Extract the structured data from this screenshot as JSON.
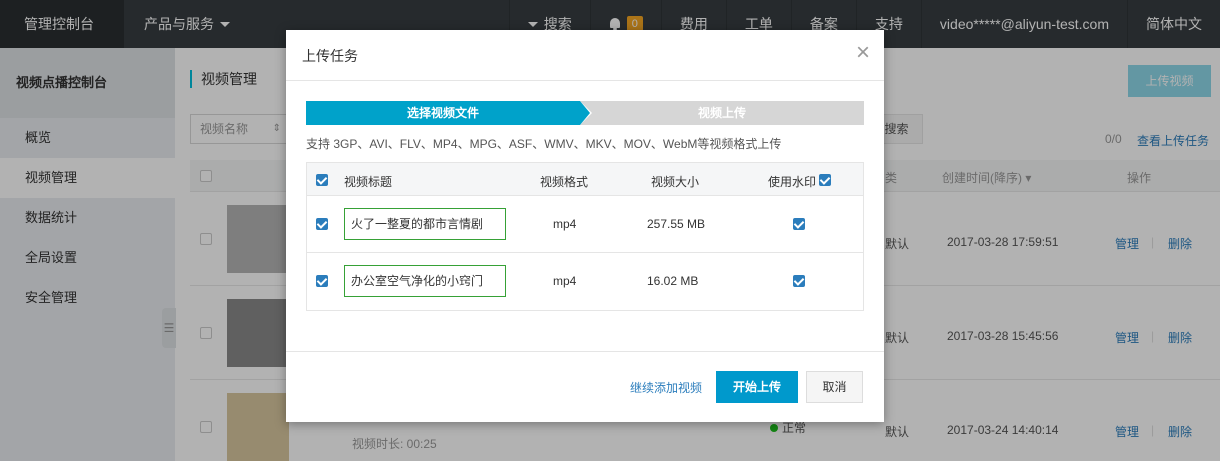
{
  "topbar": {
    "brand": "管理控制台",
    "products": "产品与服务",
    "search": "搜索",
    "notifications_count": "0",
    "fees": "费用",
    "tickets": "工单",
    "filing": "备案",
    "support": "支持",
    "account": "video*****@aliyun-test.com",
    "language": "简体中文"
  },
  "sidebar": {
    "title": "视频点播控制台",
    "items": [
      {
        "label": "概览"
      },
      {
        "label": "视频管理"
      },
      {
        "label": "数据统计"
      },
      {
        "label": "全局设置"
      },
      {
        "label": "安全管理"
      }
    ],
    "active_index": 1
  },
  "main": {
    "page_title": "视频管理",
    "upload_button": "上传视频",
    "filter_select": "视频名称",
    "search_button": "搜索",
    "count": "0/0",
    "view_tasks": "查看上传任务",
    "columns": {
      "type": "类",
      "created_time": "创建时间(降序)",
      "operations": "操作"
    },
    "rows": [
      {
        "type": "默认",
        "time": "2017-03-28 17:59:51",
        "manage": "管理",
        "sep": "|",
        "delete": "删除",
        "duration": "",
        "status": ""
      },
      {
        "type": "默认",
        "time": "2017-03-28 15:45:56",
        "manage": "管理",
        "sep": "|",
        "delete": "删除",
        "duration": "",
        "status": ""
      },
      {
        "type": "默认",
        "time": "2017-03-24 14:40:14",
        "manage": "管理",
        "sep": "|",
        "delete": "删除",
        "duration": "视频时长: 00:25",
        "status": "正常"
      }
    ]
  },
  "dialog": {
    "title": "上传任务",
    "close": "×",
    "steps": [
      "选择视频文件",
      "视频上传"
    ],
    "support_text": "支持 3GP、AVI、FLV、MP4、MPG、ASF、WMV、MKV、MOV、WebM等视频格式上传",
    "columns": {
      "title": "视频标题",
      "format": "视频格式",
      "size": "视频大小",
      "watermark": "使用水印"
    },
    "files": [
      {
        "title": "火了一整夏的都市言情剧",
        "format": "mp4",
        "size": "257.55 MB",
        "selected": true,
        "watermark": true
      },
      {
        "title": "办公室空气净化的小窍门",
        "format": "mp4",
        "size": "16.02 MB",
        "selected": true,
        "watermark": true
      }
    ],
    "add_more": "继续添加视频",
    "start": "开始上传",
    "cancel": "取消"
  }
}
